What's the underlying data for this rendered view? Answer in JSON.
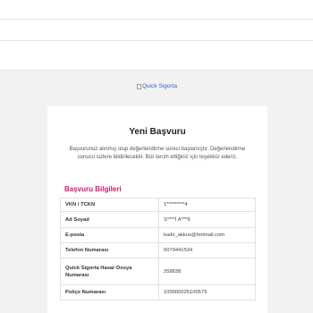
{
  "logo": {
    "alt_text": "Quick Sigorta"
  },
  "card": {
    "title": "Yeni Başvuru",
    "description": "Başvurunuz alınmış olup değerlendirme süreci başlamıştır. Değerlendirme sonucu sizlere bildirilecektir. Bizi tercih ettiğiniz için teşekkür ederiz.",
    "section_title": "Başvuru Bilgileri",
    "rows": [
      {
        "label": "VKN / TCKN",
        "value": "1*********4"
      },
      {
        "label": "Ad Soyad",
        "value": "S****İ A***9"
      },
      {
        "label": "E-posta",
        "value": "kadir_akkus@hotmail.com"
      },
      {
        "label": "Telefon Numarası",
        "value": "5079441534"
      },
      {
        "label": "Quick Sigorta Hasar Dosya Numarası",
        "value": "258838"
      },
      {
        "label": "Poliçe Numarası",
        "value": "100000025100579"
      }
    ]
  },
  "colors": {
    "accent": "#d6176f",
    "page_background": "#f2f2f2",
    "card_background": "#ffffff"
  }
}
